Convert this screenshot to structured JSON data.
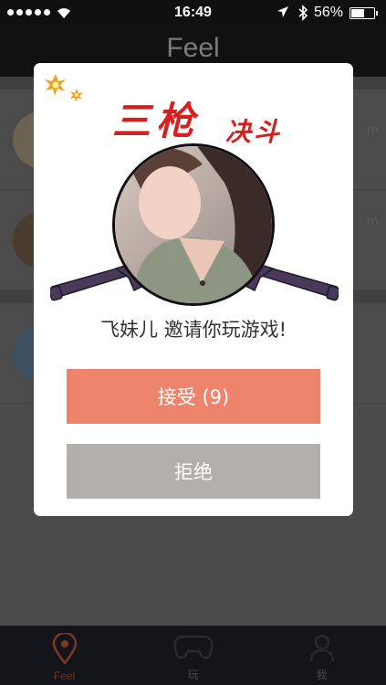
{
  "status_bar": {
    "time": "16:49",
    "battery_percent": "56%",
    "battery_level": 0.56
  },
  "nav": {
    "title": "Feel"
  },
  "feed": {
    "rows": [
      {
        "meta": "m"
      },
      {
        "meta": "m"
      },
      {
        "meta": ""
      }
    ]
  },
  "dialog": {
    "title": "三枪",
    "subtitle": "决斗",
    "invite_text": "飞妹儿 邀请你玩游戏!",
    "accept_label": "接受 (9)",
    "decline_label": "拒绝"
  },
  "tab_bar": {
    "tabs": [
      {
        "label": "Feel",
        "icon": "location-pin-icon",
        "active": true
      },
      {
        "label": "玩",
        "icon": "gamepad-icon",
        "active": false
      },
      {
        "label": "我",
        "icon": "person-icon",
        "active": false
      }
    ]
  },
  "colors": {
    "accept": "#ee836b",
    "decline": "#b3afaa",
    "title_red": "#d61f1f",
    "active_tab": "#6a3520"
  }
}
